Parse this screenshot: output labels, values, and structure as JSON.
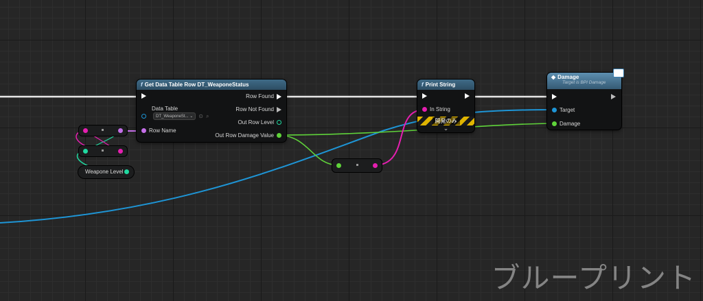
{
  "nodes": {
    "get_data_table_row": {
      "title": "Get Data Table Row DT_WeaponeStatus",
      "data_table_label": "Data Table",
      "data_table_value": "DT_WeaponeSt...",
      "row_name_label": "Row Name",
      "row_found_label": "Row Found",
      "row_not_found_label": "Row Not Found",
      "out_row_level_label": "Out Row Level",
      "out_row_damage_label": "Out Row Damage Value"
    },
    "print_string": {
      "title": "Print String",
      "in_string_label": "In String",
      "dev_only_label": "開発のみ"
    },
    "damage": {
      "title": "Damage",
      "subtitle": "Target is BPI Damage",
      "target_label": "Target",
      "damage_label": "Damage"
    },
    "weapone_level": {
      "label": "Weapone Level"
    }
  },
  "watermark": "ブループリント",
  "colors": {
    "exec": "#ffffff",
    "string_pin": "#e55fd0",
    "name_pin": "#c56fe8",
    "integer_pin": "#20d9a0",
    "float_pin": "#5fd33a",
    "object_pin": "#1e95d6"
  }
}
